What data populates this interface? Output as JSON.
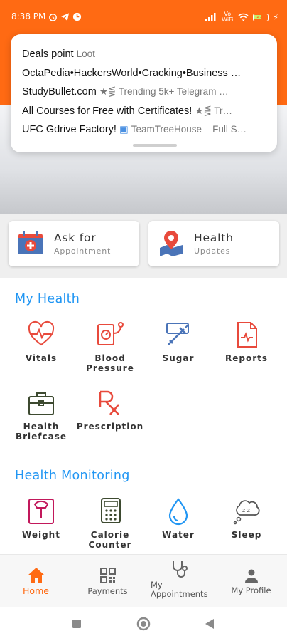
{
  "colors": {
    "primary": "#ff6a13",
    "accent_blue": "#2196f3",
    "icon_red": "#e84a3c",
    "icon_blue": "#4a74b8"
  },
  "status_bar": {
    "time": "8:38 PM",
    "network": "Vo WiFi",
    "battery": "23"
  },
  "notifications": [
    {
      "title": "Deals point",
      "detail": "Loot"
    },
    {
      "title": "OctaPedia•HackersWorld•Cracking•Business …",
      "detail": ""
    },
    {
      "title": "StudyBullet.com",
      "detail": "★⋚ Trending 5k+ Telegram …"
    },
    {
      "title": "All Courses for Free with Certificates!",
      "detail": "★⋚ Tr…"
    },
    {
      "title": "UFC Gdrive Factory!",
      "detail": "TeamTreeHouse – Full S…"
    }
  ],
  "quick_cards": [
    {
      "title": "Ask for",
      "subtitle": "Appointment",
      "icon": "calendar-medical-icon"
    },
    {
      "title": "Health",
      "subtitle": "Updates",
      "icon": "map-pin-health-icon"
    }
  ],
  "sections": {
    "my_health": {
      "title": "My Health",
      "items": [
        {
          "label": "Vitals",
          "icon": "heart-pulse-icon"
        },
        {
          "label": "Blood\nPressure",
          "icon": "blood-pressure-icon"
        },
        {
          "label": "Sugar",
          "icon": "syringe-icon"
        },
        {
          "label": "Reports",
          "icon": "report-document-icon"
        },
        {
          "label": "Health\nBriefcase",
          "icon": "briefcase-icon"
        },
        {
          "label": "Prescription",
          "icon": "rx-icon"
        }
      ]
    },
    "health_monitoring": {
      "title": "Health Monitoring",
      "items": [
        {
          "label": "Weight",
          "icon": "weight-scale-icon"
        },
        {
          "label": "Calorie\nCounter",
          "icon": "calculator-icon"
        },
        {
          "label": "Water",
          "icon": "water-drop-icon"
        },
        {
          "label": "Sleep",
          "icon": "sleep-icon"
        }
      ]
    }
  },
  "bottom_nav": [
    {
      "label": "Home",
      "icon": "home-icon",
      "active": true
    },
    {
      "label": "Payments",
      "icon": "qr-code-icon",
      "active": false
    },
    {
      "label": "My\nAppointments",
      "icon": "stethoscope-icon",
      "active": false
    },
    {
      "label": "My Profile",
      "icon": "profile-icon",
      "active": false
    }
  ]
}
